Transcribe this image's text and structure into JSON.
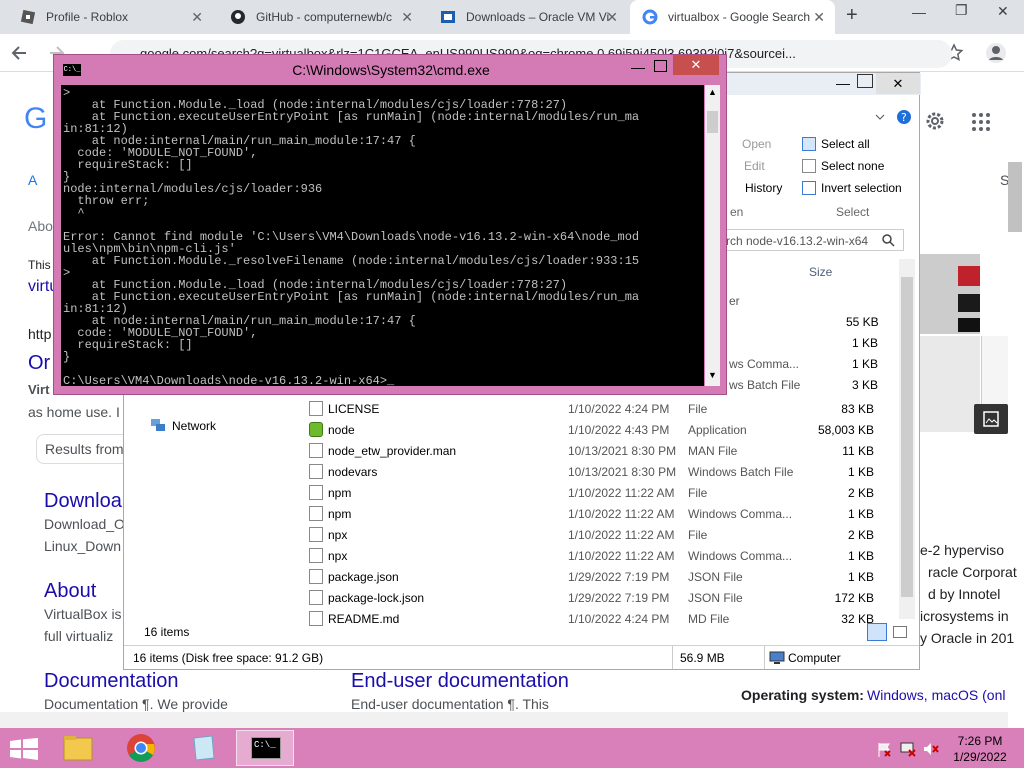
{
  "browser": {
    "tabs": [
      {
        "label": "Profile - Roblox",
        "close": "✕"
      },
      {
        "label": "GitHub - computernewb/c",
        "close": "✕"
      },
      {
        "label": "Downloads – Oracle VM Vi",
        "close": "✕"
      },
      {
        "label": "virtualbox - Google Search",
        "close": "✕"
      }
    ],
    "new_tab": "+",
    "url": "google.com/search?q=virtualbox&rlz=1C1GCEA_enUS990US990&oq=chrome.0.69i59i450l3.69392j0j7&sourcei...",
    "window_controls": {
      "minimize": "—",
      "restore": "❐",
      "close": "✕"
    }
  },
  "google": {
    "logo_partial": "G",
    "tab_all_partial": "A",
    "about_partial": "Abo",
    "this_partial": "This",
    "virtu_partial": "virtu",
    "http_partial": "http",
    "or_partial": "Or",
    "virt_bold_partial": "Virt",
    "home_use_partial": "as home use. I",
    "results_from": "Results from",
    "download_heading": "Downloa",
    "download_line1": "Download_O",
    "download_line2": "Linux_Down",
    "about_heading": "About",
    "about_line1": "VirtualBox is",
    "about_line2": "full virtualiz",
    "documentation_heading": "Documentation",
    "documentation_line": "Documentation ¶. We provide",
    "enduser_heading": "End-user documentation",
    "enduser_line": "End-user documentation ¶. This",
    "side_s": "S",
    "kp_lines": [
      "e-2 hyperviso",
      "racle Corporat",
      "d by Innotel",
      "icrosystems in",
      "y Oracle in 201"
    ],
    "os_label": "Operating system:",
    "os_value": "Windows, macOS (onl"
  },
  "explorer": {
    "ribbon": {
      "open": "Open",
      "edit": "Edit",
      "history": "History",
      "open_group": "en",
      "select_all": "Select all",
      "select_none": "Select none",
      "invert_selection": "Invert selection",
      "select_group": "Select"
    },
    "search_placeholder": "rch node-v16.13.2-win-x64",
    "col_size": "Size",
    "partial_rows": [
      {
        "type": "er",
        "size": ""
      },
      {
        "type": "",
        "size": "55 KB"
      },
      {
        "type": "",
        "size": "1 KB"
      },
      {
        "type": "ws Comma...",
        "size": "1 KB"
      },
      {
        "type": "ws Batch File",
        "size": "3 KB"
      }
    ],
    "nav_network": "Network",
    "files": [
      {
        "name": "LICENSE",
        "date": "1/10/2022 4:24 PM",
        "type": "File",
        "size": "83 KB"
      },
      {
        "name": "node",
        "date": "1/10/2022 4:43 PM",
        "type": "Application",
        "size": "58,003 KB"
      },
      {
        "name": "node_etw_provider.man",
        "date": "10/13/2021 8:30 PM",
        "type": "MAN File",
        "size": "11 KB"
      },
      {
        "name": "nodevars",
        "date": "10/13/2021 8:30 PM",
        "type": "Windows Batch File",
        "size": "1 KB"
      },
      {
        "name": "npm",
        "date": "1/10/2022 11:22 AM",
        "type": "File",
        "size": "2 KB"
      },
      {
        "name": "npm",
        "date": "1/10/2022 11:22 AM",
        "type": "Windows Comma...",
        "size": "1 KB"
      },
      {
        "name": "npx",
        "date": "1/10/2022 11:22 AM",
        "type": "File",
        "size": "2 KB"
      },
      {
        "name": "npx",
        "date": "1/10/2022 11:22 AM",
        "type": "Windows Comma...",
        "size": "1 KB"
      },
      {
        "name": "package.json",
        "date": "1/29/2022 7:19 PM",
        "type": "JSON File",
        "size": "1 KB"
      },
      {
        "name": "package-lock.json",
        "date": "1/29/2022 7:19 PM",
        "type": "JSON File",
        "size": "172 KB"
      },
      {
        "name": "README.md",
        "date": "1/10/2022 4:24 PM",
        "type": "MD File",
        "size": "32 KB"
      }
    ],
    "item_count": "16 items",
    "status_left": "16 items (Disk free space: 91.2 GB)",
    "status_size": "56.9 MB",
    "status_location": "Computer"
  },
  "cmd": {
    "title": "C:\\Windows\\System32\\cmd.exe",
    "icon_text": "C:\\_",
    "lines": [
      ">",
      "    at Function.Module._load (node:internal/modules/cjs/loader:778:27)",
      "    at Function.executeUserEntryPoint [as runMain] (node:internal/modules/run_ma",
      "in:81:12)",
      "    at node:internal/main/run_main_module:17:47 {",
      "  code: 'MODULE_NOT_FOUND',",
      "  requireStack: []",
      "}",
      "node:internal/modules/cjs/loader:936",
      "  throw err;",
      "  ^",
      "",
      "Error: Cannot find module 'C:\\Users\\VM4\\Downloads\\node-v16.13.2-win-x64\\node_mod",
      "ules\\npm\\bin\\npm-cli.js'",
      "    at Function.Module._resolveFilename (node:internal/modules/cjs/loader:933:15",
      ">",
      "    at Function.Module._load (node:internal/modules/cjs/loader:778:27)",
      "    at Function.executeUserEntryPoint [as runMain] (node:internal/modules/run_ma",
      "in:81:12)",
      "    at node:internal/main/run_main_module:17:47 {",
      "  code: 'MODULE_NOT_FOUND',",
      "  requireStack: []",
      "}",
      "",
      "C:\\Users\\VM4\\Downloads\\node-v16.13.2-win-x64>_"
    ]
  },
  "taskbar": {
    "time": "7:26 PM",
    "date": "1/29/2022",
    "cmd_icon_text": "C:\\_"
  }
}
